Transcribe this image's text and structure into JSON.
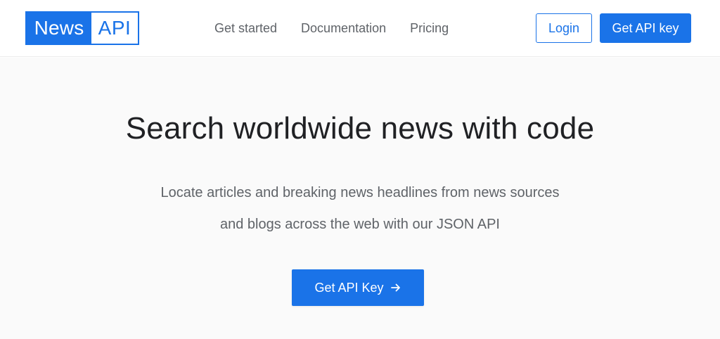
{
  "brand": {
    "logo_word_1": "News",
    "logo_word_2": "API",
    "accent_color": "#1a73e8"
  },
  "nav": {
    "links": [
      {
        "label": "Get started"
      },
      {
        "label": "Documentation"
      },
      {
        "label": "Pricing"
      }
    ],
    "login_label": "Login",
    "get_key_label": "Get API key"
  },
  "hero": {
    "title": "Search worldwide news with code",
    "subtitle": "Locate articles and breaking news headlines from news sources and blogs across the web with our JSON API",
    "cta_label": "Get API Key",
    "cta_icon": "arrow-right-icon"
  }
}
